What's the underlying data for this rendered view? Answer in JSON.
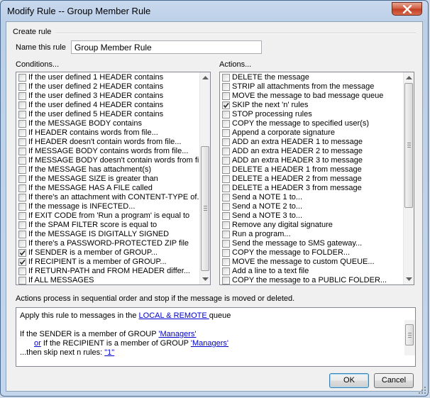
{
  "window": {
    "title": "Modify Rule -- Group Member Rule"
  },
  "group": {
    "title": "Create rule"
  },
  "name_field": {
    "label": "Name this rule",
    "value": "Group Member Rule"
  },
  "conditions": {
    "label": "Conditions...",
    "items": [
      {
        "text": "If the user defined 1 HEADER contains",
        "checked": false
      },
      {
        "text": "If the user defined 2 HEADER contains",
        "checked": false
      },
      {
        "text": "If the user defined 3 HEADER contains",
        "checked": false
      },
      {
        "text": "If the user defined 4 HEADER contains",
        "checked": false
      },
      {
        "text": "If the user defined 5 HEADER contains",
        "checked": false
      },
      {
        "text": "If the MESSAGE BODY contains",
        "checked": false
      },
      {
        "text": "If HEADER contains words from file...",
        "checked": false
      },
      {
        "text": "If HEADER doesn't contain words from file...",
        "checked": false
      },
      {
        "text": "If MESSAGE BODY contains words from file...",
        "checked": false
      },
      {
        "text": "If MESSAGE BODY doesn't contain words from file",
        "checked": false
      },
      {
        "text": "If the MESSAGE has attachment(s)",
        "checked": false
      },
      {
        "text": "If the MESSAGE SIZE is greater than",
        "checked": false
      },
      {
        "text": "If the MESSAGE HAS A FILE called",
        "checked": false
      },
      {
        "text": "If there's an attachment with CONTENT-TYPE of...",
        "checked": false
      },
      {
        "text": "If the message is INFECTED...",
        "checked": false
      },
      {
        "text": "If EXIT CODE from 'Run a program' is equal to",
        "checked": false
      },
      {
        "text": "If the SPAM FILTER score is equal to",
        "checked": false
      },
      {
        "text": "If the MESSAGE IS DIGITALLY SIGNED",
        "checked": false
      },
      {
        "text": "If there's a PASSWORD-PROTECTED ZIP file",
        "checked": false
      },
      {
        "text": "If SENDER is a member of GROUP...",
        "checked": true
      },
      {
        "text": "If RECIPIENT is a member of GROUP...",
        "checked": true
      },
      {
        "text": "If RETURN-PATH and FROM HEADER differ...",
        "checked": false
      },
      {
        "text": "If ALL MESSAGES",
        "checked": false
      }
    ]
  },
  "actions": {
    "label": "Actions...",
    "items": [
      {
        "text": "DELETE the message",
        "checked": false
      },
      {
        "text": "STRIP all attachments from the message",
        "checked": false
      },
      {
        "text": "MOVE the message to bad message queue",
        "checked": false
      },
      {
        "text": "SKIP the next 'n' rules",
        "checked": true
      },
      {
        "text": "STOP processing rules",
        "checked": false
      },
      {
        "text": "COPY the message to specified user(s)",
        "checked": false
      },
      {
        "text": "Append a corporate signature",
        "checked": false
      },
      {
        "text": "ADD an extra HEADER 1 to message",
        "checked": false
      },
      {
        "text": "ADD an extra HEADER 2 to message",
        "checked": false
      },
      {
        "text": "ADD an extra HEADER 3 to message",
        "checked": false
      },
      {
        "text": "DELETE a HEADER 1 from message",
        "checked": false
      },
      {
        "text": "DELETE a HEADER 2 from message",
        "checked": false
      },
      {
        "text": "DELETE a HEADER 3 from message",
        "checked": false
      },
      {
        "text": "Send a NOTE 1 to...",
        "checked": false
      },
      {
        "text": "Send a NOTE 2 to...",
        "checked": false
      },
      {
        "text": "Send a NOTE 3 to...",
        "checked": false
      },
      {
        "text": "Remove any digital signature",
        "checked": false
      },
      {
        "text": "Run a program...",
        "checked": false
      },
      {
        "text": "Send the message to SMS gateway...",
        "checked": false
      },
      {
        "text": "COPY the message to FOLDER...",
        "checked": false
      },
      {
        "text": "MOVE the message to custom QUEUE...",
        "checked": false
      },
      {
        "text": "Add a line to a text file",
        "checked": false
      },
      {
        "text": "COPY the message to a PUBLIC FOLDER...",
        "checked": false
      }
    ]
  },
  "note": "Actions process in sequential order and stop if the message is moved or deleted.",
  "summary": {
    "line1_prefix": "Apply this rule to messages in the ",
    "line1_link": "LOCAL & REMOTE ",
    "line1_suffix": " queue",
    "line2_prefix": "If the SENDER is a member of GROUP ",
    "line2_link": "'Managers'",
    "line3_or": "or",
    "line3_prefix": " If the RECIPIENT is a member of GROUP ",
    "line3_link": "'Managers'",
    "line4_prefix": "...then skip next n rules: ",
    "line4_link": "\"1\""
  },
  "buttons": {
    "ok": "OK",
    "cancel": "Cancel"
  }
}
